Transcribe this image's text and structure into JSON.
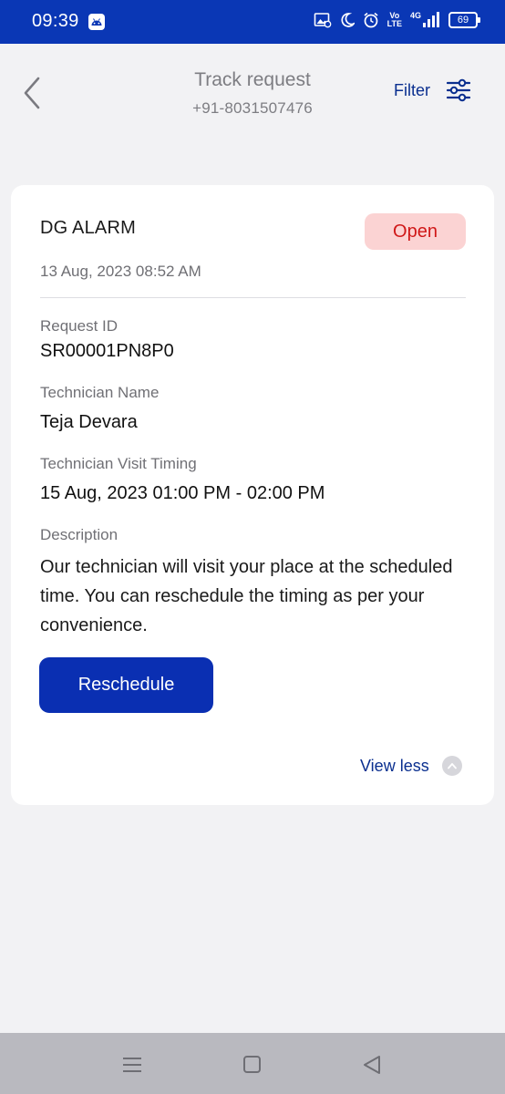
{
  "status_bar": {
    "time": "09:39",
    "volte_top": "Vo",
    "volte_bottom": "LTE",
    "network": "4G",
    "battery": "69"
  },
  "header": {
    "title": "Track request",
    "subtitle": "+91-8031507476",
    "filter_label": "Filter"
  },
  "card": {
    "title": "DG ALARM",
    "status": "Open",
    "date": "13 Aug, 2023 08:52 AM",
    "request_id_label": "Request ID",
    "request_id": "SR00001PN8P0",
    "technician_label": "Technician Name",
    "technician_name": "Teja Devara",
    "visit_label": "Technician Visit Timing",
    "visit_timing": "15 Aug, 2023 01:00 PM - 02:00 PM",
    "description_label": "Description",
    "description": "Our technician will visit your place at the scheduled time. You can reschedule the timing as per your convenience.",
    "reschedule_label": "Reschedule",
    "view_less_label": "View less"
  },
  "colors": {
    "brand_blue": "#0a37b5",
    "status_open_bg": "#fbd3d3",
    "status_open_text": "#d01818"
  }
}
